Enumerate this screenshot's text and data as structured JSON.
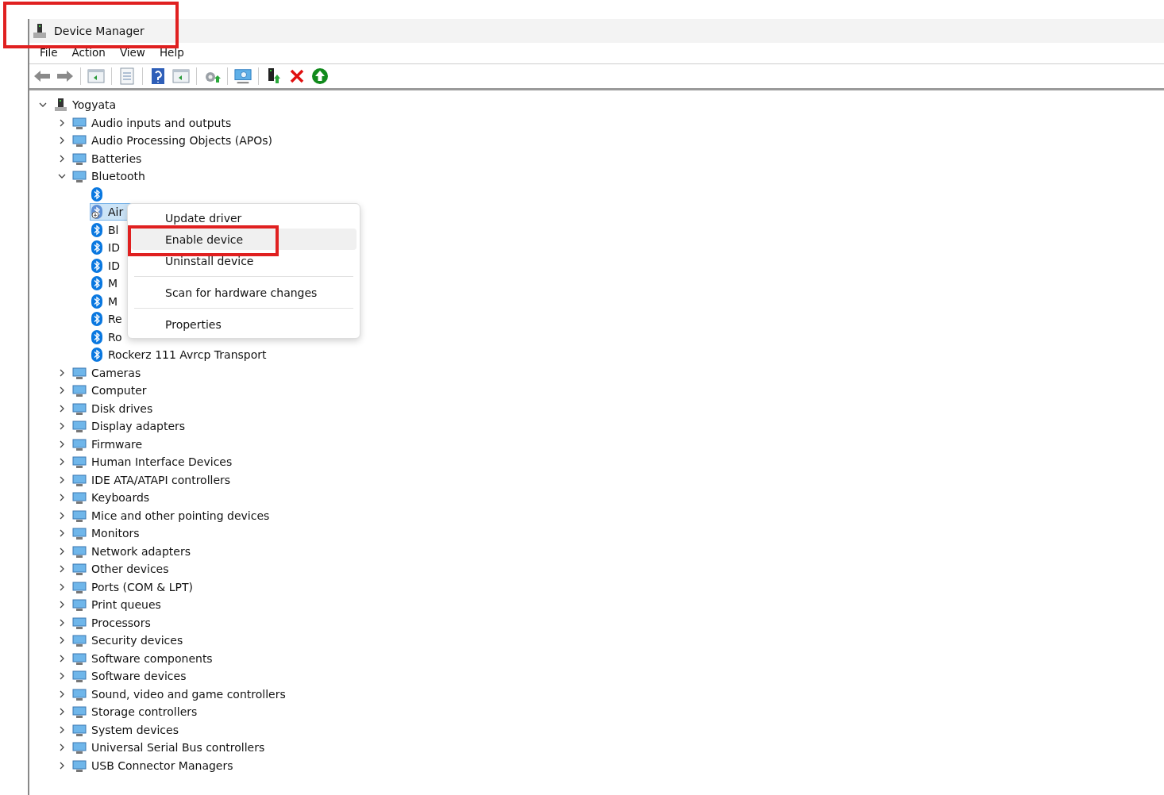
{
  "window": {
    "title": "Device Manager",
    "highlighted": true
  },
  "menu_bar": [
    "File",
    "Action",
    "View",
    "Help"
  ],
  "toolbar": [
    {
      "kind": "back"
    },
    {
      "kind": "forward"
    },
    {
      "kind": "sep"
    },
    {
      "kind": "pane"
    },
    {
      "kind": "sep"
    },
    {
      "kind": "sheet"
    },
    {
      "kind": "sep"
    },
    {
      "kind": "help"
    },
    {
      "kind": "pane"
    },
    {
      "kind": "sep"
    },
    {
      "kind": "gear"
    },
    {
      "kind": "sep"
    },
    {
      "kind": "monitor"
    },
    {
      "kind": "sep"
    },
    {
      "kind": "plug"
    },
    {
      "kind": "remove"
    },
    {
      "kind": "up"
    }
  ],
  "tree": {
    "label": "Yogyata",
    "expanded": true,
    "children": [
      {
        "label": "Audio inputs and outputs",
        "expanded": false
      },
      {
        "label": "Audio Processing Objects (APOs)",
        "expanded": false
      },
      {
        "label": "Batteries",
        "expanded": false
      },
      {
        "label": "Bluetooth",
        "expanded": true,
        "children": [
          {
            "selected": false,
            "disabled": false
          },
          {
            "label": "Air",
            "selected": true,
            "disabled": true
          },
          {
            "label": "Bl",
            "selected": false,
            "disabled": false
          },
          {
            "label": "ID",
            "selected": false,
            "disabled": false
          },
          {
            "label": "ID",
            "selected": false,
            "disabled": false
          },
          {
            "label": "M",
            "selected": false,
            "disabled": false
          },
          {
            "label": "M",
            "selected": false,
            "disabled": false
          },
          {
            "label": "Re",
            "selected": false,
            "disabled": false
          },
          {
            "label": "Ro",
            "selected": false,
            "disabled": false
          },
          {
            "label": "Rockerz 111 Avrcp Transport",
            "selected": false,
            "disabled": false
          }
        ]
      },
      {
        "label": "Cameras",
        "expanded": false
      },
      {
        "label": "Computer",
        "expanded": false
      },
      {
        "label": "Disk drives",
        "expanded": false
      },
      {
        "label": "Display adapters",
        "expanded": false
      },
      {
        "label": "Firmware",
        "expanded": false
      },
      {
        "label": "Human Interface Devices",
        "expanded": false
      },
      {
        "label": "IDE ATA/ATAPI controllers",
        "expanded": false
      },
      {
        "label": "Keyboards",
        "expanded": false
      },
      {
        "label": "Mice and other pointing devices",
        "expanded": false
      },
      {
        "label": "Monitors",
        "expanded": false
      },
      {
        "label": "Network adapters",
        "expanded": false
      },
      {
        "label": "Other devices",
        "expanded": false
      },
      {
        "label": "Ports (COM & LPT)",
        "expanded": false
      },
      {
        "label": "Print queues",
        "expanded": false
      },
      {
        "label": "Processors",
        "expanded": false
      },
      {
        "label": "Security devices",
        "expanded": false
      },
      {
        "label": "Software components",
        "expanded": false
      },
      {
        "label": "Software devices",
        "expanded": false
      },
      {
        "label": "Sound, video and game controllers",
        "expanded": false
      },
      {
        "label": "Storage controllers",
        "expanded": false
      },
      {
        "label": "System devices",
        "expanded": false
      },
      {
        "label": "Universal Serial Bus controllers",
        "expanded": false
      },
      {
        "label": "USB Connector Managers",
        "expanded": false
      }
    ]
  },
  "context_menu": [
    {
      "kind": "item",
      "label": "Update driver",
      "hovered": false,
      "highlighted": false
    },
    {
      "kind": "item",
      "label": "Enable device",
      "hovered": true,
      "highlighted": true
    },
    {
      "kind": "item",
      "label": "Uninstall device",
      "hovered": false,
      "highlighted": false
    },
    {
      "kind": "separator"
    },
    {
      "kind": "item",
      "label": "Scan for hardware changes",
      "hovered": false,
      "highlighted": false
    },
    {
      "kind": "separator"
    },
    {
      "kind": "item",
      "label": "Properties",
      "hovered": false,
      "highlighted": false
    }
  ]
}
